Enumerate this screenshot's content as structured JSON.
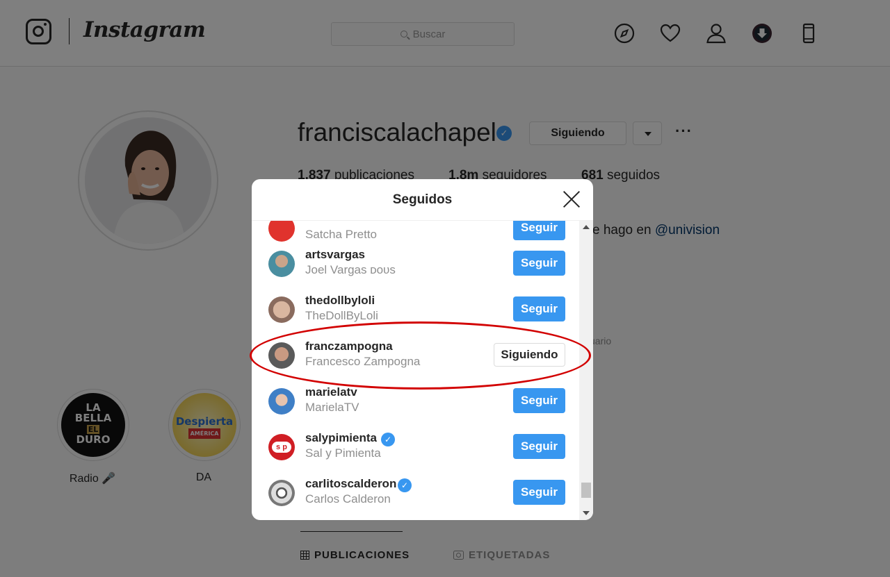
{
  "nav": {
    "brand": "Instagram",
    "search_placeholder": "Buscar",
    "icons": [
      "compass-icon",
      "heart-icon",
      "user-icon",
      "download-icon",
      "mobile-icon"
    ]
  },
  "profile": {
    "username": "franciscalachapel",
    "following_button": "Siguiendo",
    "more": "···",
    "stats": {
      "posts": "1.837",
      "posts_label": "publicaciones",
      "followers": "1.8m",
      "followers_label": "seguidores",
      "following": "681",
      "following_label": "seguidos"
    },
    "bio_visible": "e hago en ",
    "bio_mention": "@univision",
    "bio_small": "uario"
  },
  "highlights": [
    {
      "label": "Radio 🎤",
      "badge_lines": [
        "LA",
        "BELLA",
        "EL",
        "DURO"
      ]
    },
    {
      "label": "DA",
      "badge_lines": [
        "Despierta",
        "AMÉRICA"
      ]
    }
  ],
  "tabs": {
    "posts": "PUBLICACIONES",
    "tagged": "ETIQUETADAS"
  },
  "modal": {
    "title": "Seguidos",
    "rows": [
      {
        "username": "",
        "fullname": "Satcha Pretto",
        "verified": false,
        "button": "Seguir",
        "following": false
      },
      {
        "username": "artsvargas",
        "fullname": "Joel Vargas ᴅᴏᴜs",
        "verified": false,
        "button": "Seguir",
        "following": false
      },
      {
        "username": "thedollbyloli",
        "fullname": "TheDollByLoli",
        "verified": false,
        "button": "Seguir",
        "following": false
      },
      {
        "username": "franczampogna",
        "fullname": "Francesco Zampogna",
        "verified": false,
        "button": "Siguiendo",
        "following": true
      },
      {
        "username": "marielatv",
        "fullname": "MarielaTV",
        "verified": false,
        "button": "Seguir",
        "following": false
      },
      {
        "username": "salypimienta",
        "fullname": "Sal y Pimienta",
        "verified": true,
        "button": "Seguir",
        "following": false
      },
      {
        "username": "carlitoscalderon",
        "fullname": "Carlos Calderon",
        "verified": true,
        "button": "Seguir",
        "following": false
      }
    ]
  },
  "colors": {
    "accent": "#3897f0",
    "annotation": "#d20000",
    "overlay": "rgba(0,0,0,0.5)"
  }
}
